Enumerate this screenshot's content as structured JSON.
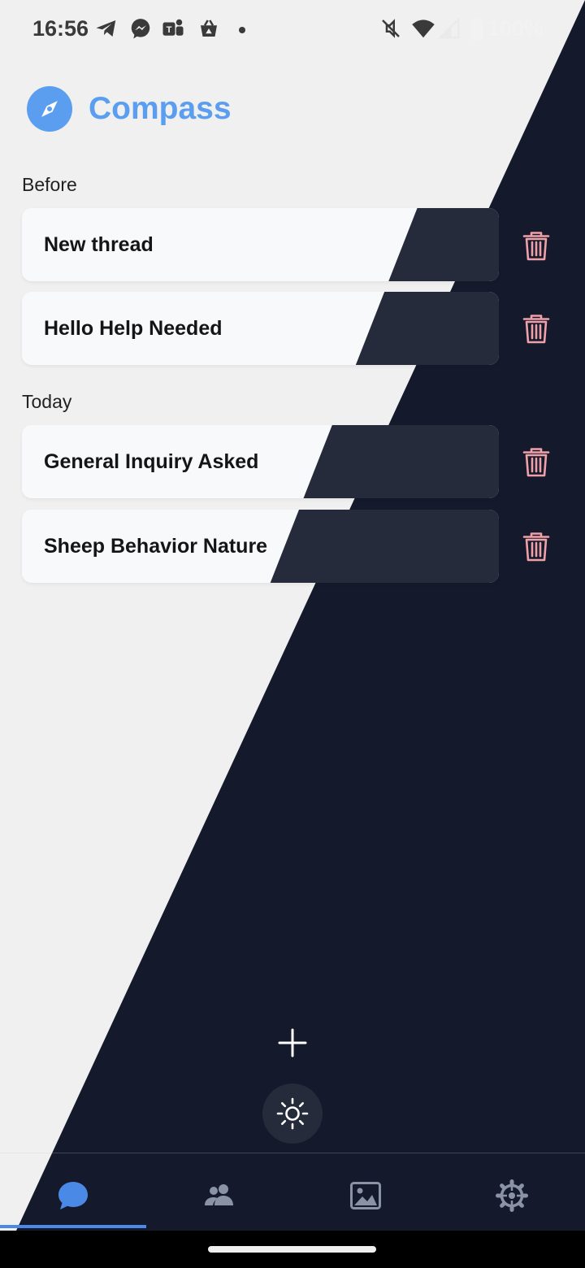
{
  "status_bar": {
    "time": "16:56",
    "battery_text": "100%",
    "notification_icons": [
      "telegram-icon",
      "messenger-icon",
      "teams-icon",
      "store-icon"
    ],
    "system_icons": [
      "mute-icon",
      "wifi-icon",
      "signal-icon",
      "battery-icon"
    ]
  },
  "header": {
    "title": "Compass",
    "logo_icon": "compass-icon",
    "accent_color": "#5b9ef0"
  },
  "sections": [
    {
      "label": "Before",
      "threads": [
        {
          "title": "New thread"
        },
        {
          "title": "Hello Help Needed"
        }
      ]
    },
    {
      "label": "Today",
      "threads": [
        {
          "title": "General Inquiry Asked"
        },
        {
          "title": "Sheep Behavior Nature"
        }
      ]
    }
  ],
  "actions": {
    "delete_icon": "trash-icon",
    "delete_color": "#f0a0a8",
    "add_icon": "plus-icon",
    "theme_icon": "sun-icon"
  },
  "nav": {
    "items": [
      {
        "icon": "chat-bubble-icon",
        "active": true
      },
      {
        "icon": "people-icon",
        "active": false
      },
      {
        "icon": "image-icon",
        "active": false
      },
      {
        "icon": "settings-gear-icon",
        "active": false
      }
    ],
    "active_color": "#4a8ae6",
    "inactive_color": "#8a93a6"
  },
  "theme": {
    "light_bg": "#f0f0f0",
    "dark_bg": "#141a2b"
  }
}
